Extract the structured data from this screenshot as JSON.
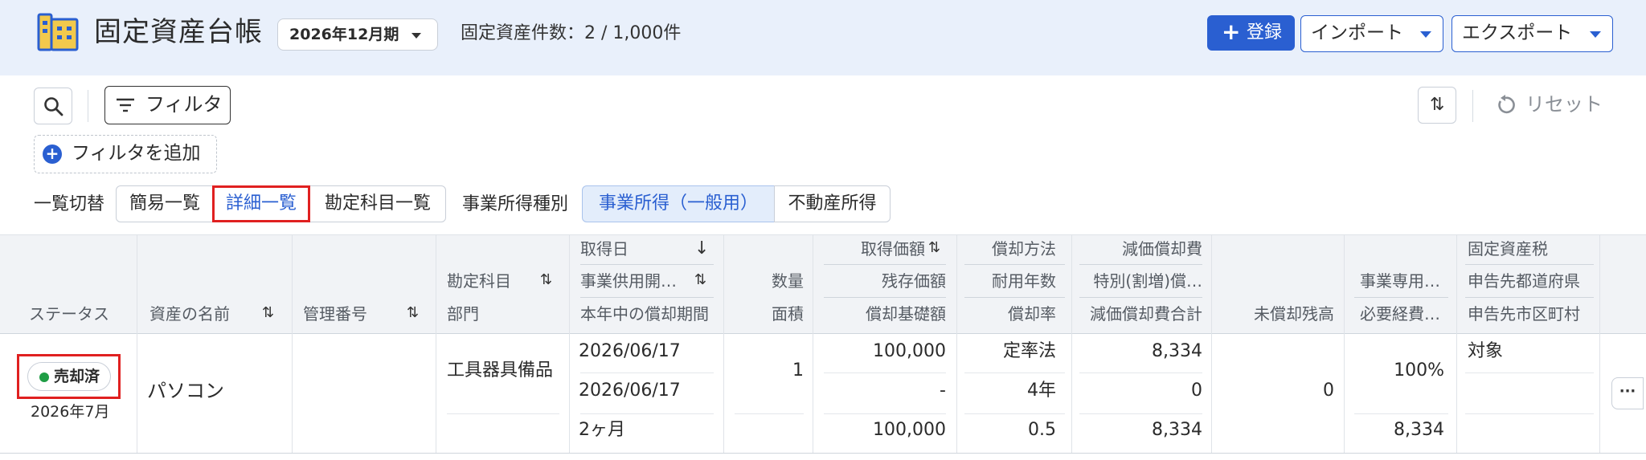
{
  "header": {
    "title": "固定資産台帳",
    "period": "2026年12月期",
    "count_text": "固定資産件数：2 / 1,000件",
    "register_label": "登録",
    "import_label": "インポート",
    "export_label": "エクスポート"
  },
  "toolbar": {
    "filter_label": "フィルタ",
    "reset_label": "リセット",
    "add_filter_label": "フィルタを追加",
    "view_switch_label": "一覧切替",
    "views": [
      "簡易一覧",
      "詳細一覧",
      "勘定科目一覧"
    ],
    "selected_view": "詳細一覧",
    "income_type_label": "事業所得種別",
    "income_types": [
      "事業所得（一般用）",
      "不動産所得"
    ],
    "selected_income_type": "事業所得（一般用）"
  },
  "columns": {
    "status": "ステータス",
    "asset_name": "資産の名前",
    "management_no": "管理番号",
    "account": "勘定科目",
    "department": "部門",
    "acquisition_date": "取得日",
    "service_start": "事業供用開…",
    "period_in_year": "本年中の償却期間",
    "quantity": "数量",
    "area": "面積",
    "acquisition_cost": "取得価額",
    "residual_value": "残存価額",
    "depreciation_base": "償却基礎額",
    "method": "償却方法",
    "useful_life": "耐用年数",
    "rate": "償却率",
    "depreciation": "減価償却費",
    "special": "特別(割増)償…",
    "depreciation_total": "減価償却費合計",
    "unamortized": "未償却残高",
    "business_ratio": "事業専用…",
    "expense": "必要経費…",
    "property_tax": "固定資産税",
    "prefecture": "申告先都道府県",
    "city": "申告先市区町村"
  },
  "rows": [
    {
      "status": "売却済",
      "status_date": "2026年7月",
      "asset_name": "パソコン",
      "management_no": "",
      "account": "工具器具備品",
      "acquisition_date": "2026/06/17",
      "service_start": "2026/06/17",
      "period_in_year": "2ヶ月",
      "quantity": "1",
      "acquisition_cost": "100,000",
      "residual_value": "-",
      "depreciation_base": "100,000",
      "method": "定率法",
      "useful_life": "4年",
      "rate": "0.5",
      "depreciation": "8,334",
      "special": "0",
      "depreciation_total": "8,334",
      "unamortized": "0",
      "business_ratio": "100%",
      "expense": "8,334",
      "property_tax": "対象"
    }
  ],
  "colors": {
    "accent": "#2a5fd1",
    "header_bg": "#e9f0fb",
    "highlight": "#e02020",
    "sold_dot": "#1f9d45"
  }
}
